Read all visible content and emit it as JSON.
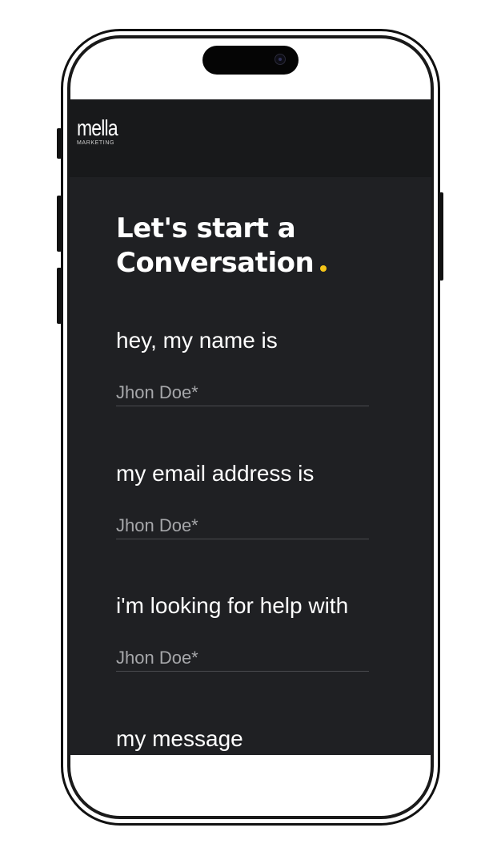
{
  "brand": {
    "logo_text": "mella",
    "logo_subtext": "MARKETING"
  },
  "form": {
    "title_line1": "Let's start a",
    "title_line2": "Conversation",
    "accent_color": "#f5c518",
    "name_label": "hey, my name is",
    "name_placeholder": "Jhon Doe*",
    "email_label": "my email address is",
    "email_placeholder": "Jhon Doe*",
    "help_label": "i'm looking for help with",
    "help_placeholder": "Jhon Doe*",
    "message_label": "my message"
  }
}
